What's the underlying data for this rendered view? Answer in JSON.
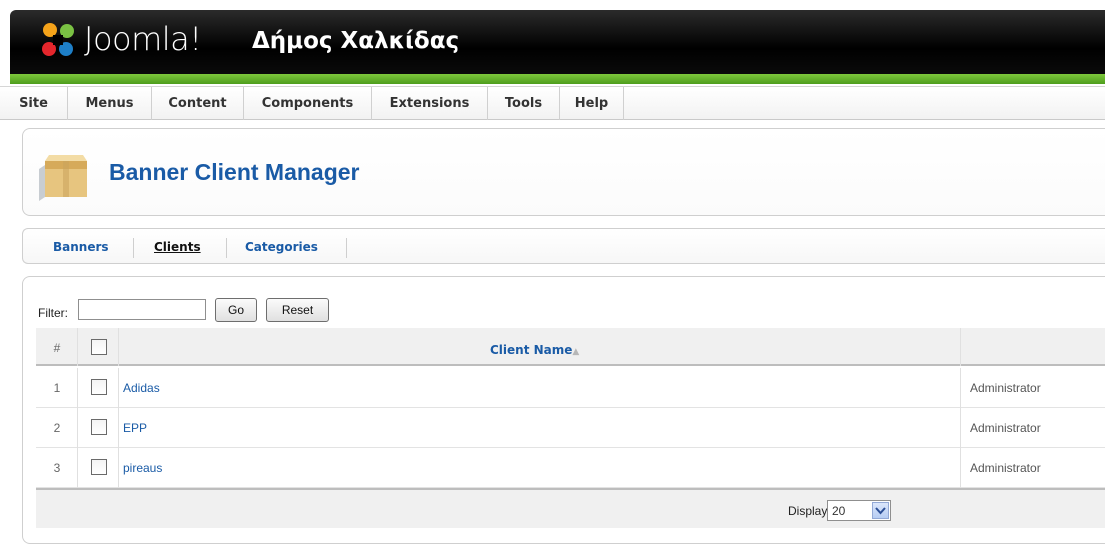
{
  "header": {
    "brand": "Joomla!",
    "site_name": "Δήμος Χαλκίδας",
    "colors": {
      "bar": "#000000",
      "accent": "#5aa623"
    }
  },
  "menu": {
    "items": [
      {
        "label": "Site"
      },
      {
        "label": "Menus"
      },
      {
        "label": "Content"
      },
      {
        "label": "Components"
      },
      {
        "label": "Extensions"
      },
      {
        "label": "Tools"
      },
      {
        "label": "Help"
      }
    ]
  },
  "page": {
    "title": "Banner Client Manager",
    "icon": "box-icon"
  },
  "submenu": {
    "items": [
      {
        "label": "Banners",
        "active": false
      },
      {
        "label": "Clients",
        "active": true
      },
      {
        "label": "Categories",
        "active": false
      }
    ]
  },
  "filter": {
    "label": "Filter:",
    "value": "",
    "go_label": "Go",
    "reset_label": "Reset"
  },
  "table": {
    "columns": {
      "num": "#",
      "name": "Client Name",
      "sort_indicator": "▲"
    },
    "rows": [
      {
        "num": "1",
        "name": "Adidas",
        "checked_out": "Administrator"
      },
      {
        "num": "2",
        "name": "EPP",
        "checked_out": "Administrator"
      },
      {
        "num": "3",
        "name": "pireaus",
        "checked_out": "Administrator"
      }
    ],
    "footer": {
      "display_label": "Display #",
      "display_value": "20"
    }
  }
}
